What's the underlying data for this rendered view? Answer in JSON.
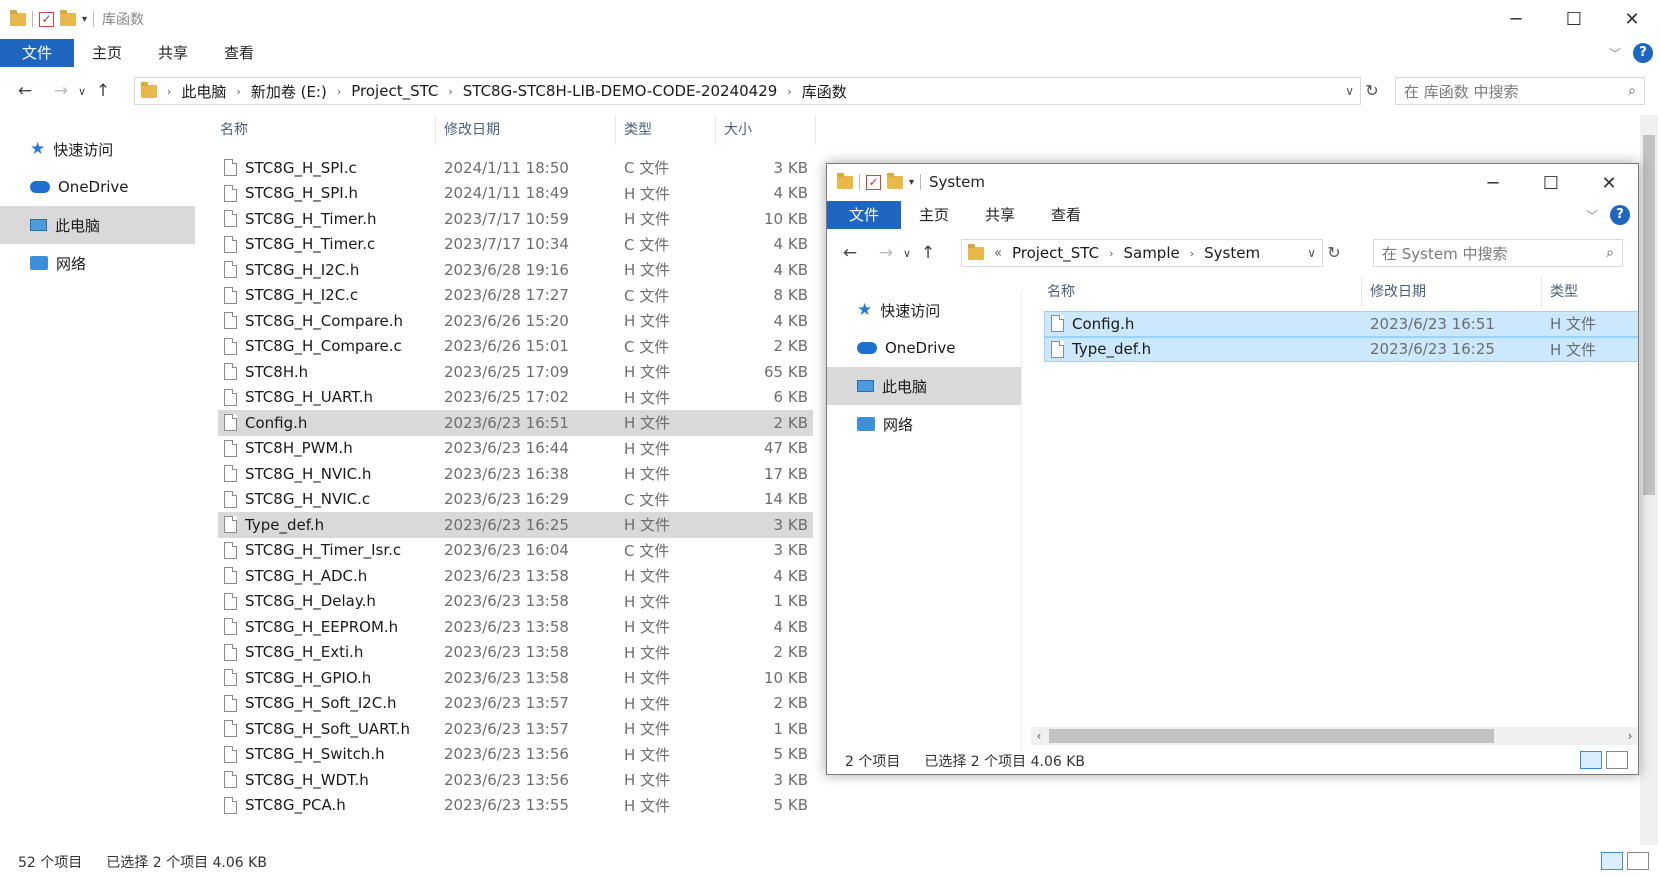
{
  "main": {
    "title": "库函数",
    "ribbon": {
      "file": "文件",
      "home": "主页",
      "share": "共享",
      "view": "查看",
      "help": "?"
    },
    "address": {
      "crumbs": [
        "此电脑",
        "新加卷 (E:)",
        "Project_STC",
        "STC8G-STC8H-LIB-DEMO-CODE-20240429",
        "库函数"
      ]
    },
    "search_placeholder": "在 库函数 中搜索",
    "sidebar": [
      {
        "label": "快速访问",
        "icon": "star-icon"
      },
      {
        "label": "OneDrive",
        "icon": "cloud-icon"
      },
      {
        "label": "此电脑",
        "icon": "computer-icon"
      },
      {
        "label": "网络",
        "icon": "network-icon"
      }
    ],
    "columns": {
      "name": "名称",
      "date": "修改日期",
      "type": "类型",
      "size": "大小"
    },
    "files": [
      {
        "name": "STC8G_H_SPI.c",
        "date": "2024/1/11 18:50",
        "type": "C 文件",
        "size": "3 KB"
      },
      {
        "name": "STC8G_H_SPI.h",
        "date": "2024/1/11 18:49",
        "type": "H 文件",
        "size": "4 KB"
      },
      {
        "name": "STC8G_H_Timer.h",
        "date": "2023/7/17 10:59",
        "type": "H 文件",
        "size": "10 KB"
      },
      {
        "name": "STC8G_H_Timer.c",
        "date": "2023/7/17 10:34",
        "type": "C 文件",
        "size": "4 KB"
      },
      {
        "name": "STC8G_H_I2C.h",
        "date": "2023/6/28 19:16",
        "type": "H 文件",
        "size": "4 KB"
      },
      {
        "name": "STC8G_H_I2C.c",
        "date": "2023/6/28 17:27",
        "type": "C 文件",
        "size": "8 KB"
      },
      {
        "name": "STC8G_H_Compare.h",
        "date": "2023/6/26 15:20",
        "type": "H 文件",
        "size": "4 KB"
      },
      {
        "name": "STC8G_H_Compare.c",
        "date": "2023/6/26 15:01",
        "type": "C 文件",
        "size": "2 KB"
      },
      {
        "name": "STC8H.h",
        "date": "2023/6/25 17:09",
        "type": "H 文件",
        "size": "65 KB"
      },
      {
        "name": "STC8G_H_UART.h",
        "date": "2023/6/25 17:02",
        "type": "H 文件",
        "size": "6 KB"
      },
      {
        "name": "Config.h",
        "date": "2023/6/23 16:51",
        "type": "H 文件",
        "size": "2 KB",
        "selected": true
      },
      {
        "name": "STC8H_PWM.h",
        "date": "2023/6/23 16:44",
        "type": "H 文件",
        "size": "47 KB"
      },
      {
        "name": "STC8G_H_NVIC.h",
        "date": "2023/6/23 16:38",
        "type": "H 文件",
        "size": "17 KB"
      },
      {
        "name": "STC8G_H_NVIC.c",
        "date": "2023/6/23 16:29",
        "type": "C 文件",
        "size": "14 KB"
      },
      {
        "name": "Type_def.h",
        "date": "2023/6/23 16:25",
        "type": "H 文件",
        "size": "3 KB",
        "selected": true
      },
      {
        "name": "STC8G_H_Timer_Isr.c",
        "date": "2023/6/23 16:04",
        "type": "C 文件",
        "size": "3 KB"
      },
      {
        "name": "STC8G_H_ADC.h",
        "date": "2023/6/23 13:58",
        "type": "H 文件",
        "size": "4 KB"
      },
      {
        "name": "STC8G_H_Delay.h",
        "date": "2023/6/23 13:58",
        "type": "H 文件",
        "size": "1 KB"
      },
      {
        "name": "STC8G_H_EEPROM.h",
        "date": "2023/6/23 13:58",
        "type": "H 文件",
        "size": "4 KB"
      },
      {
        "name": "STC8G_H_Exti.h",
        "date": "2023/6/23 13:58",
        "type": "H 文件",
        "size": "2 KB"
      },
      {
        "name": "STC8G_H_GPIO.h",
        "date": "2023/6/23 13:58",
        "type": "H 文件",
        "size": "10 KB"
      },
      {
        "name": "STC8G_H_Soft_I2C.h",
        "date": "2023/6/23 13:57",
        "type": "H 文件",
        "size": "2 KB"
      },
      {
        "name": "STC8G_H_Soft_UART.h",
        "date": "2023/6/23 13:57",
        "type": "H 文件",
        "size": "1 KB"
      },
      {
        "name": "STC8G_H_Switch.h",
        "date": "2023/6/23 13:56",
        "type": "H 文件",
        "size": "5 KB"
      },
      {
        "name": "STC8G_H_WDT.h",
        "date": "2023/6/23 13:56",
        "type": "H 文件",
        "size": "3 KB"
      },
      {
        "name": "STC8G_PCA.h",
        "date": "2023/6/23 13:55",
        "type": "H 文件",
        "size": "5 KB"
      }
    ],
    "status": {
      "count": "52 个项目",
      "selected": "已选择 2 个项目  4.06 KB"
    }
  },
  "sub": {
    "title": "System",
    "ribbon": {
      "file": "文件",
      "home": "主页",
      "share": "共享",
      "view": "查看",
      "help": "?"
    },
    "address": {
      "overflow": "«",
      "crumbs": [
        "Project_STC",
        "Sample",
        "System"
      ]
    },
    "search_placeholder": "在 System 中搜索",
    "sidebar": [
      {
        "label": "快速访问",
        "icon": "star-icon"
      },
      {
        "label": "OneDrive",
        "icon": "cloud-icon"
      },
      {
        "label": "此电脑",
        "icon": "computer-icon"
      },
      {
        "label": "网络",
        "icon": "network-icon"
      }
    ],
    "columns": {
      "name": "名称",
      "date": "修改日期",
      "type": "类型"
    },
    "files": [
      {
        "name": "Config.h",
        "date": "2023/6/23 16:51",
        "type": "H 文件"
      },
      {
        "name": "Type_def.h",
        "date": "2023/6/23 16:25",
        "type": "H 文件"
      }
    ],
    "status": {
      "count": "2 个项目",
      "selected": "已选择 2 个项目  4.06 KB"
    }
  },
  "colors": {
    "accent": "#1e66c0",
    "selection": "#cce8ff",
    "inactive_selection": "#d9d9d9"
  }
}
